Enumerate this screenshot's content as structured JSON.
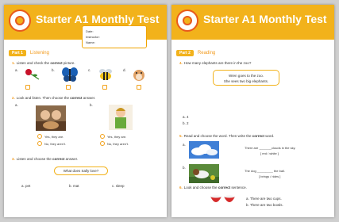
{
  "left": {
    "title": "Starter A1 Monthly Test",
    "info": {
      "date": "Date:",
      "instructor": "Instructor:",
      "name": "Name:"
    },
    "part1": {
      "badge": "Part 1",
      "title": "Listening"
    },
    "q1": {
      "num": "1.",
      "pre": "Listen and check the",
      "bold": "correct",
      "post": "picture.",
      "labels": [
        "a.",
        "b.",
        "c.",
        "d."
      ]
    },
    "q2": {
      "num": "2.",
      "pre": "Look and listen. Then choose the",
      "bold": "correct",
      "post": "answer.",
      "labels": [
        "a.",
        "b."
      ],
      "opt_yes": "Yes, they are.",
      "opt_no": "No, they aren't."
    },
    "q3": {
      "num": "3.",
      "pre": "Listen and choose the",
      "bold": "correct",
      "post": "answer.",
      "prompt": "What does Sally love?",
      "options": [
        "a.  pet",
        "b.  mat",
        "c.  sleep"
      ]
    }
  },
  "right": {
    "title": "Starter A1 Monthly Test",
    "part2": {
      "badge": "Part 2",
      "title": "Reading"
    },
    "q4": {
      "num": "4.",
      "text": "How many elephants are there in the zoo?",
      "bubble1": "Wren goes to the zoo.",
      "bubble2": "She sees two big elephants.",
      "opt_a": "a.  4",
      "opt_b": "b.  2"
    },
    "q5": {
      "num": "5.",
      "pre": "Read and choose the word. Then write the",
      "bold": "correct",
      "post": "word.",
      "a_label": "a.",
      "a_text": "There are _______clouds in the sky.",
      "a_choices": "[ red / white ]",
      "b_label": "b.",
      "b_text": "The dog _________ the ball.",
      "b_choices": "[ brings / rides ]"
    },
    "q6": {
      "num": "6.",
      "pre": "Look and choose the",
      "bold": "correct",
      "post": "sentence.",
      "opt_a": "a.  There are two cups.",
      "opt_b": "b.  There are two bowls."
    }
  },
  "colors": {
    "header": "#f2b21b",
    "accent": "#f29a1b"
  }
}
